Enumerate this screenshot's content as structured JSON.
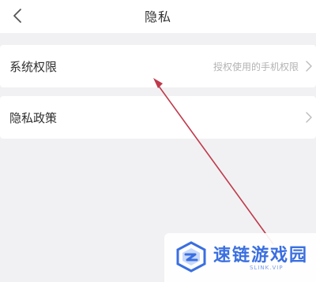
{
  "header": {
    "title": "隐私",
    "back_icon": "chevron-left-icon"
  },
  "settings": [
    {
      "label": "系统权限",
      "value": "授权使用的手机权限",
      "icon": "chevron-right-icon"
    },
    {
      "label": "隐私政策",
      "value": "",
      "icon": "chevron-right-icon"
    }
  ],
  "annotation": {
    "arrow_color": "#c0394b"
  },
  "watermark": {
    "name": "速链游戏园",
    "url": "SLINK.VIP",
    "color": "#3a6fe0"
  }
}
